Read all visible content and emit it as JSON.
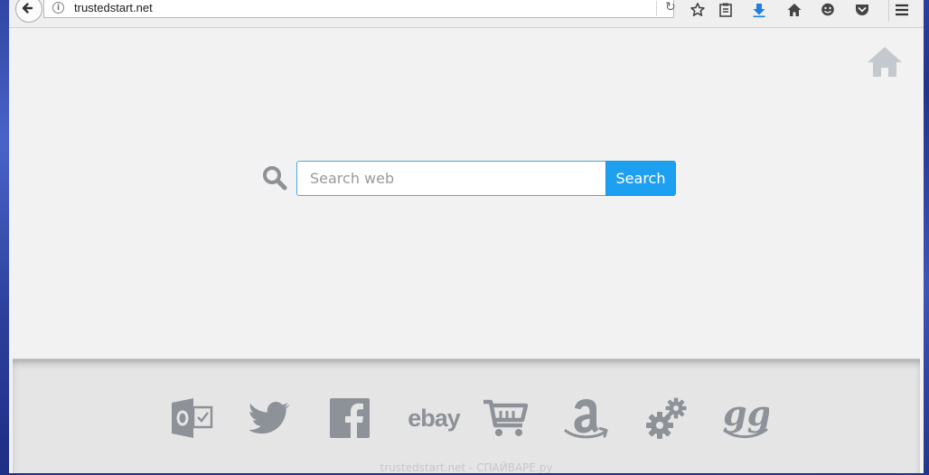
{
  "browser": {
    "url": "trustedstart.net",
    "info_glyph": "i",
    "reload_glyph": "↻",
    "toolbar_icons": [
      "star-icon",
      "reading-list-icon",
      "download-icon",
      "home-icon",
      "hello-icon",
      "pocket-icon",
      "menu-icon"
    ]
  },
  "search": {
    "placeholder": "Search web",
    "button_label": "Search"
  },
  "quick_links": [
    {
      "name": "outlook",
      "icon": "outlook-icon"
    },
    {
      "name": "twitter",
      "icon": "twitter-icon"
    },
    {
      "name": "facebook",
      "icon": "facebook-icon"
    },
    {
      "name": "ebay",
      "label": "ebay"
    },
    {
      "name": "shopping",
      "icon": "cart-icon"
    },
    {
      "name": "amazon",
      "icon": "amazon-icon"
    },
    {
      "name": "settings",
      "icon": "gear-icon"
    },
    {
      "name": "gg",
      "icon": "gg-icon"
    }
  ],
  "watermark": "trustedstart.net - СПАЙВАРЕ.ру",
  "colors": {
    "accent": "#1ea0f0",
    "icon_gray": "#8d9198",
    "page_bg": "#f2f2f2",
    "footer_bg": "#e5e5e5",
    "desktop_bg": "#2b3f9a"
  }
}
